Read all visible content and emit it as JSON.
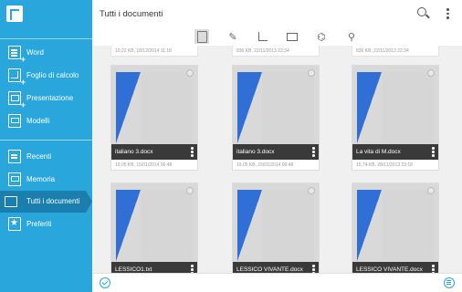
{
  "sidebar": {
    "items": [
      {
        "label": "Word",
        "icon": "word-add-icon"
      },
      {
        "label": "Foglio di calcolo",
        "icon": "spreadsheet-add-icon"
      },
      {
        "label": "Presentazione",
        "icon": "presentation-add-icon"
      },
      {
        "label": "Modelli",
        "icon": "templates-icon"
      },
      {
        "label": "Recenti",
        "icon": "recent-icon"
      },
      {
        "label": "Memoria",
        "icon": "storage-icon"
      },
      {
        "label": "Tutti i documenti",
        "icon": "all-documents-icon",
        "active": true
      },
      {
        "label": "Preferiti",
        "icon": "favorites-star-icon"
      }
    ]
  },
  "header": {
    "title": "Tutti i documenti"
  },
  "filters": [
    "all-files-icon",
    "document-filter-icon",
    "spreadsheet-filter-icon",
    "presentation-filter-icon",
    "pdf-filter-icon",
    "other-filter-icon"
  ],
  "grid": {
    "prev_row_meta": [
      "10,22 KB, 18/12/2014 11:18",
      "836 KB, 22/11/2013 22:34",
      "836 KB, 22/11/2013 22:34"
    ],
    "cards": [
      {
        "name": "italiano 3.docx",
        "meta": "19,05 KB, 15/01/2014 06:48"
      },
      {
        "name": "italiano 3.docx",
        "meta": "19,05 KB, 15/01/2014 06:48"
      },
      {
        "name": "La vita di M.docx",
        "meta": "15,74 KB, 28/11/2013 23:18"
      },
      {
        "name": "LESSICO1.txt",
        "meta": ""
      },
      {
        "name": "LESSICO VIVANTE.docx",
        "meta": ""
      },
      {
        "name": "LESSICO VIVANTE.docx",
        "meta": ""
      }
    ]
  },
  "colors": {
    "sidebar": "#29a6dc",
    "sidebar_active": "#1a7fae",
    "doc_blue": "#2f6fd6"
  }
}
